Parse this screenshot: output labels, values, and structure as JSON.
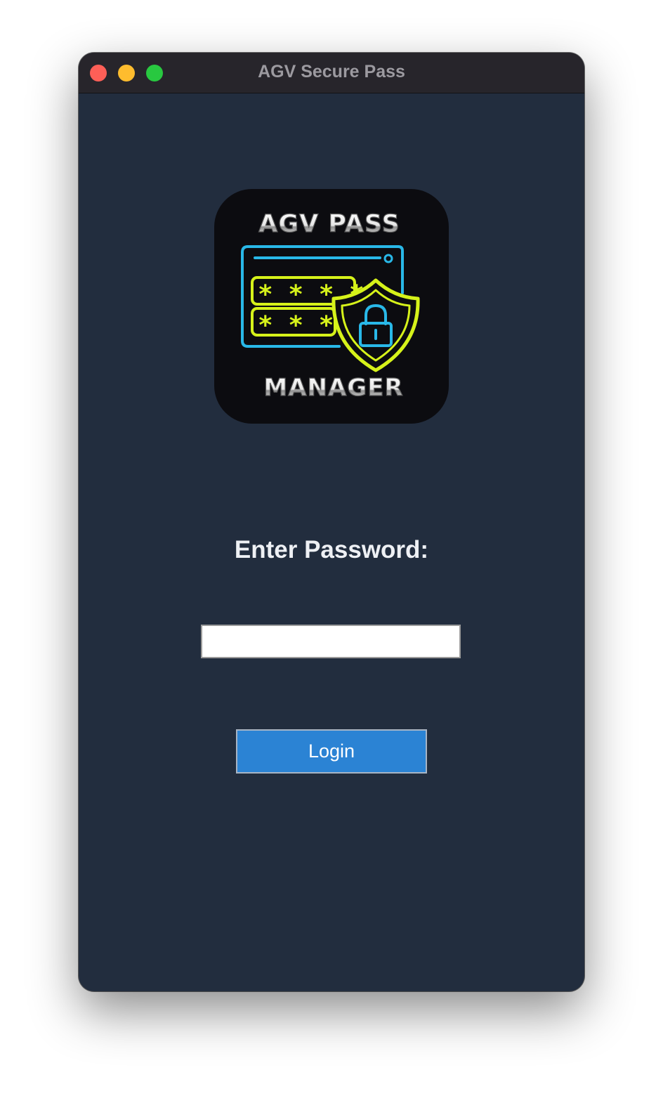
{
  "window": {
    "title": "AGV Secure Pass",
    "background_color": "#222d3e",
    "titlebar_color": "#27252b"
  },
  "traffic_lights": {
    "close_color": "#fe5f57",
    "minimize_color": "#febc2e",
    "maximize_color": "#28c840"
  },
  "logo": {
    "top_text": "AGV PASS",
    "bottom_text": "MANAGER",
    "line1_mask": "* * * *",
    "line2_mask": "* * *",
    "icon": "lock-shield-icon",
    "accent_colors": [
      "#29b8e8",
      "#d6f21a"
    ]
  },
  "login": {
    "prompt": "Enter Password:",
    "password_value": "",
    "button_label": "Login",
    "button_color": "#2b83d4"
  }
}
